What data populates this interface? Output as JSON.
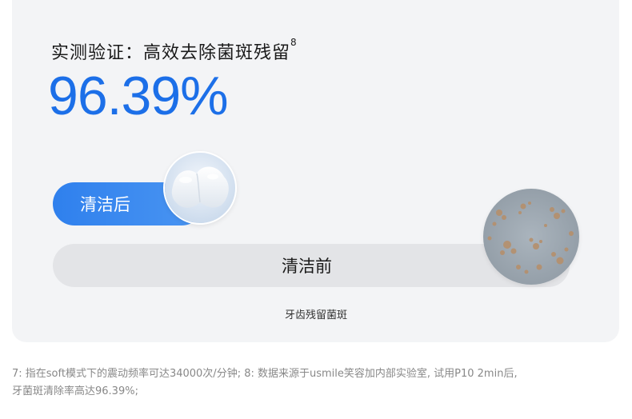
{
  "headline": {
    "text": "实测验证：高效去除菌斑残留",
    "footnote_mark": "8"
  },
  "result": {
    "value": "96.39%"
  },
  "bars": {
    "after_label": "清洁后",
    "before_label": "清洁前"
  },
  "caption": "牙齿残留菌斑",
  "footnote": {
    "line1": "7: 指在soft模式下的震动频率可达34000次/分钟; 8: 数据来源于usmile笑容加内部实验室, 试用P10 2min后,",
    "line2": "牙菌斑清除率高达96.39%;"
  },
  "colors": {
    "accent": "#1c6fe8",
    "bar_after": "#2f80ed",
    "bar_before": "#e3e4e7",
    "card_bg": "#f3f4f6"
  }
}
